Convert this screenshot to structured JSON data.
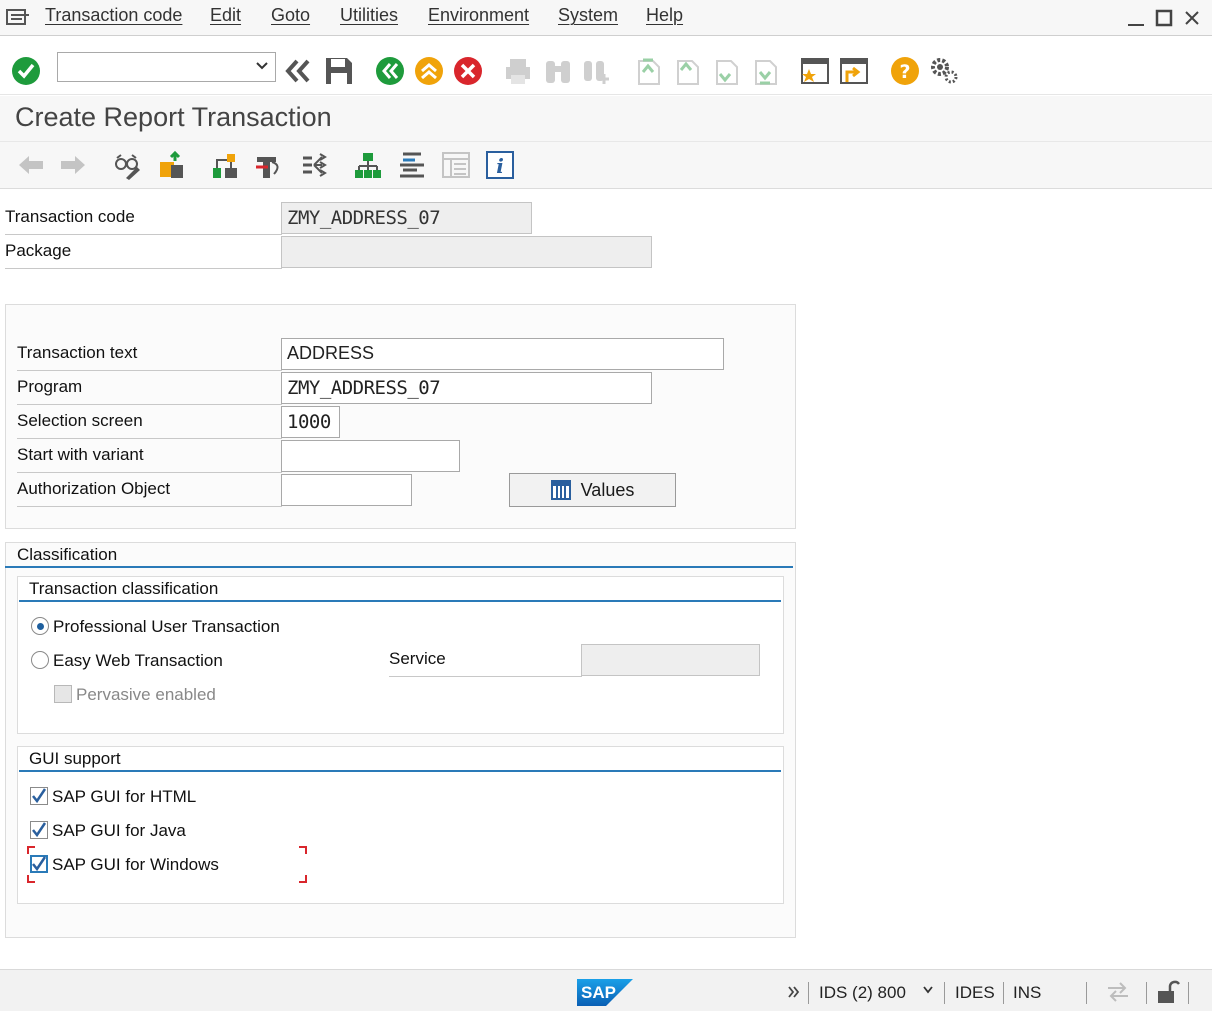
{
  "menu": {
    "items": [
      "Transaction code",
      "Edit",
      "Goto",
      "Utilities",
      "Environment",
      "System",
      "Help"
    ]
  },
  "toolbar": {
    "command_field_value": "",
    "icons": [
      "enter-icon",
      "back-history-icon",
      "save-icon",
      "back-icon",
      "exit-icon",
      "cancel-icon",
      "print-icon",
      "find-icon",
      "find-next-icon",
      "first-page-icon",
      "previous-page-icon",
      "next-page-icon",
      "last-page-icon",
      "new-session-icon",
      "shortcut-icon",
      "help-icon",
      "customize-icon"
    ]
  },
  "page": {
    "title": "Create Report Transaction"
  },
  "app_toolbar": {
    "icons": [
      "back-arrow-icon",
      "forward-arrow-icon",
      "display-change-icon",
      "other-object-icon",
      "check-icon",
      "activate-icon",
      "where-used-icon",
      "hierarchy-icon",
      "object-list-icon",
      "display-object-list-icon",
      "info-icon"
    ]
  },
  "header_fields": {
    "transaction_code_label": "Transaction code",
    "transaction_code_value": "ZMY_ADDRESS_07",
    "package_label": "Package",
    "package_value": ""
  },
  "details": {
    "transaction_text_label": "Transaction text",
    "transaction_text_value": "ADDRESS",
    "program_label": "Program",
    "program_value": "ZMY_ADDRESS_07",
    "selection_screen_label": "Selection screen",
    "selection_screen_value": "1000",
    "start_variant_label": "Start with variant",
    "start_variant_value": "",
    "auth_object_label": "Authorization Object",
    "auth_object_value": "",
    "values_button": "Values"
  },
  "classification": {
    "title": "Classification",
    "transaction_classification": {
      "title": "Transaction classification",
      "professional_label": "Professional User Transaction",
      "professional_selected": true,
      "easy_web_label": "Easy Web Transaction",
      "easy_web_selected": false,
      "service_label": "Service",
      "service_value": "",
      "pervasive_label": "Pervasive enabled",
      "pervasive_checked": false
    },
    "gui_support": {
      "title": "GUI support",
      "html_label": "SAP GUI for HTML",
      "html_checked": true,
      "java_label": "SAP GUI for Java",
      "java_checked": true,
      "windows_label": "SAP GUI for Windows",
      "windows_checked": true
    }
  },
  "status_bar": {
    "logo": "SAP",
    "system": "IDS (2) 800",
    "client": "IDES",
    "mode": "INS"
  },
  "colors": {
    "accent_blue": "#2a7ab8",
    "ok_green": "#1e9b3c",
    "cancel_red": "#d9262c",
    "warning_orange": "#f0a30a"
  }
}
